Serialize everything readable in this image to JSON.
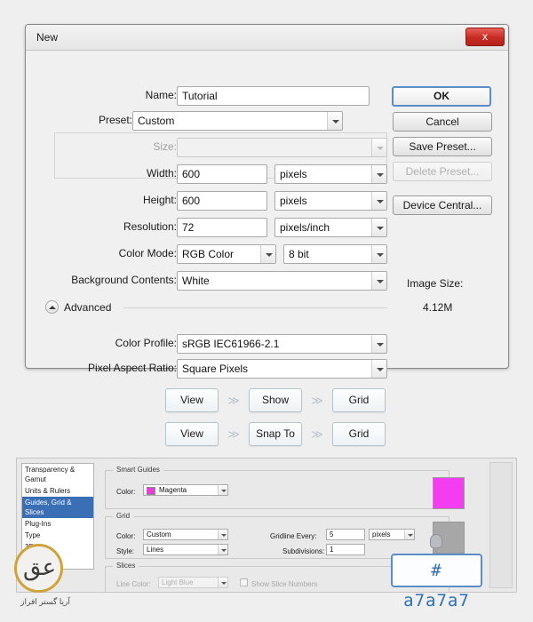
{
  "dialog": {
    "title": "New",
    "close_label": "x",
    "fields": {
      "name_label": "Name:",
      "name_value": "Tutorial",
      "preset_label": "Preset:",
      "preset_value": "Custom",
      "size_label": "Size:",
      "size_value": "",
      "width_label": "Width:",
      "width_value": "600",
      "width_unit": "pixels",
      "height_label": "Height:",
      "height_value": "600",
      "height_unit": "pixels",
      "resolution_label": "Resolution:",
      "resolution_value": "72",
      "resolution_unit": "pixels/inch",
      "colormode_label": "Color Mode:",
      "colormode_value": "RGB Color",
      "colordepth_value": "8 bit",
      "background_label": "Background Contents:",
      "background_value": "White",
      "advanced_label": "Advanced",
      "colorprofile_label": "Color Profile:",
      "colorprofile_value": "sRGB IEC61966-2.1",
      "pixelaspect_label": "Pixel Aspect Ratio:",
      "pixelaspect_value": "Square Pixels"
    },
    "buttons": {
      "ok": "OK",
      "cancel": "Cancel",
      "save_preset": "Save Preset...",
      "delete_preset": "Delete Preset...",
      "device_central": "Device Central..."
    },
    "image_size": {
      "label": "Image Size:",
      "value": "4.12M"
    }
  },
  "flows": [
    {
      "step1": "View",
      "sep1": "≫",
      "step2": "Show",
      "sep2": "≫",
      "step3": "Grid"
    },
    {
      "step1": "View",
      "sep1": "≫",
      "step2": "Snap To",
      "sep2": "≫",
      "step3": "Grid"
    }
  ],
  "prefs": {
    "categories": [
      "Transparency & Gamut",
      "Units & Rulers",
      "Guides, Grid & Slices",
      "Plug-Ins",
      "Type",
      "3D"
    ],
    "selected_category": "Guides, Grid & Slices",
    "smart_guides": {
      "title": "Smart Guides",
      "color_label": "Color:",
      "color_value": "Magenta"
    },
    "grid": {
      "title": "Grid",
      "color_label": "Color:",
      "color_value": "Custom",
      "style_label": "Style:",
      "style_value": "Lines",
      "gridline_label": "Gridline Every:",
      "gridline_value": "5",
      "gridline_unit": "pixels",
      "subdivisions_label": "Subdivisions:",
      "subdivisions_value": "1"
    },
    "slices": {
      "title": "Slices",
      "linecolor_label": "Line Color:",
      "linecolor_value": "Light Blue",
      "show_numbers_label": "Show Slice Numbers"
    },
    "swatch_colors": {
      "magenta": "#ea3ae0",
      "grid_custom": "#a7a7a7"
    }
  },
  "hex_callout": {
    "value": "# a7a7a7"
  },
  "watermark": {
    "mark": "عق",
    "caption": "آریا گستر افراز"
  }
}
